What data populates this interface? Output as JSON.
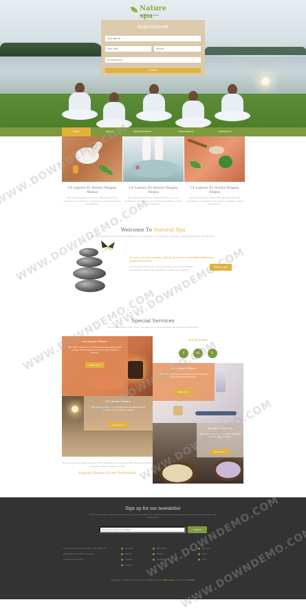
{
  "brand": {
    "name": "Nature spa",
    "tagline": "Relaxation center"
  },
  "appointment": {
    "title": "Appointment",
    "name_placeholder": "Your Name",
    "email_placeholder": "Your Mail",
    "phone_placeholder": "Phone",
    "date_placeholder": "mm/dd/yyyy",
    "submit_label": "Submit"
  },
  "nav": {
    "items": [
      "Home",
      "About",
      "Special Events",
      "Short gallery",
      "Contact Us"
    ],
    "active_index": 0
  },
  "features": [
    {
      "title": "Ut Labore Et Dolore Magna Aliqua",
      "text": "Sed ut perspiciatis unde omnis iste natus error sit voluptatem accusantium doloremque laudantium totam rem aperiam."
    },
    {
      "title": "Ut Labore Et Dolore Magna Aliqua",
      "text": "Sed ut perspiciatis unde omnis iste natus error sit voluptatem accusantium doloremque laudantium totam rem aperiam."
    },
    {
      "title": "Ut Labore Et Dolore Magna Aliqua",
      "text": "Sed ut perspiciatis unde omnis iste natus error sit voluptatem accusantium doloremque laudantium totam rem aperiam."
    }
  ],
  "welcome": {
    "title_prefix": "Welcome To",
    "title_accent": "Natural Spa",
    "subtitle": "Sed ut perspiciatis unde omnis iste natus error sit voluptatem accusantium doloremque laudantium totam rem aperiam.",
    "heading": "To take a trivial example, which of us ever undertakes laborious physical exercise",
    "text": "Sed ut perspiciatis unde omnis iste natus error sit voluptatem accusantium doloremque laudantium totam rem aperiam.",
    "more_label": "Read more"
  },
  "services": {
    "title": "Special Services",
    "subtitle": "Sed ut perspiciatis unde omnis iste natus error sit voluptatem accusantium doloremque.",
    "cards": [
      {
        "title": "Sed Aliquet Ullamco",
        "text": "Nam libero tempore, cum soluta nobis est eligendi optio cumque nihil impedit quo minus id quod maxime placeat.",
        "button": "Read more"
      },
      {
        "title": "Sed Aliquet Ullamco",
        "text": "Nam libero tempore, cum soluta nobis est eligendi optio cumque nihil impedit quo minus.",
        "button": "Read more"
      },
      {
        "title": "Sed Aliquet Ullamco",
        "text": "Nam libero tempore, cum soluta nobis est eligendi optio cumque nihil impedit.",
        "button": "Read more"
      },
      {
        "title": "Sed Aliquet Ullamco",
        "text": "Nam libero tempore, cum soluta nobis est eligendi optio cumque.",
        "button": "Read more"
      }
    ],
    "social_title": "Social Icons",
    "social_icons": [
      "f",
      "in",
      "t"
    ],
    "footer_text": "At vero eos et accusamus et iusto odio dignissimos ducimus qui blanditiis praesentium voluptatum deleniti atque corrupti.",
    "footer_heading": "Eugenie Glorious Et Aut Perferendis"
  },
  "newsletter": {
    "title": "Sign up for our newsletter",
    "subtitle": "Sed ut perspiciatis unde omnis iste natus error sit voluptatem accusantium doloremque laudantium totam rem aperiam eaque ipsa quae ab illo.",
    "email_placeholder": "Enter your email to update",
    "submit_label": "Submit"
  },
  "footer": {
    "about_lines": [
      "Ut enim ad minima veniam, quis nostrum",
      "exercitationem ullam corporis",
      "suscipit laboriosam"
    ],
    "col1": [
      "Contact",
      "About",
      "Privacy",
      "Gallery"
    ],
    "col2": [
      "Facebook",
      "Twitter",
      "Instagram"
    ],
    "col3": [
      "Services",
      "Team",
      "Blog"
    ],
    "copyright_prefix": "Copyright © 2016 Company name All rights reserved.",
    "copyright_accent": "Nature spa",
    "copyright_suffix": "- Collect from",
    "copyright_link": "Domain"
  },
  "watermark": "WWW.DOWNDEMO.COM",
  "colors": {
    "accent": "#e2b23a",
    "green": "#7d9a3f",
    "footer": "#333333"
  }
}
